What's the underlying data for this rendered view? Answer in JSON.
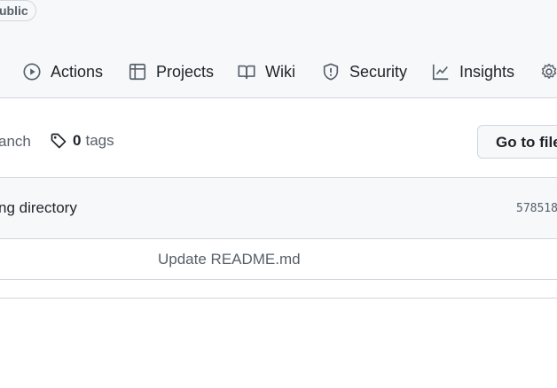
{
  "repo": {
    "visibility_badge": "ublic"
  },
  "tabs": [
    {
      "label": "Actions",
      "icon": "play-circle-icon"
    },
    {
      "label": "Projects",
      "icon": "table-icon"
    },
    {
      "label": "Wiki",
      "icon": "book-icon"
    },
    {
      "label": "Security",
      "icon": "shield-icon"
    },
    {
      "label": "Insights",
      "icon": "graph-icon"
    },
    {
      "label": "",
      "icon": "gear-icon"
    }
  ],
  "toolbar": {
    "branch_text": "anch",
    "tags_count": "0",
    "tags_label": "tags",
    "goto_file": "Go to file"
  },
  "latest_commit": {
    "message": "ng directory",
    "hash": "578518"
  },
  "files": [
    {
      "commit_message": "Update README.md"
    }
  ],
  "colors": {
    "border": "#d0d7de",
    "muted": "#57606a",
    "text": "#1f2328",
    "band": "#f6f8fa"
  }
}
